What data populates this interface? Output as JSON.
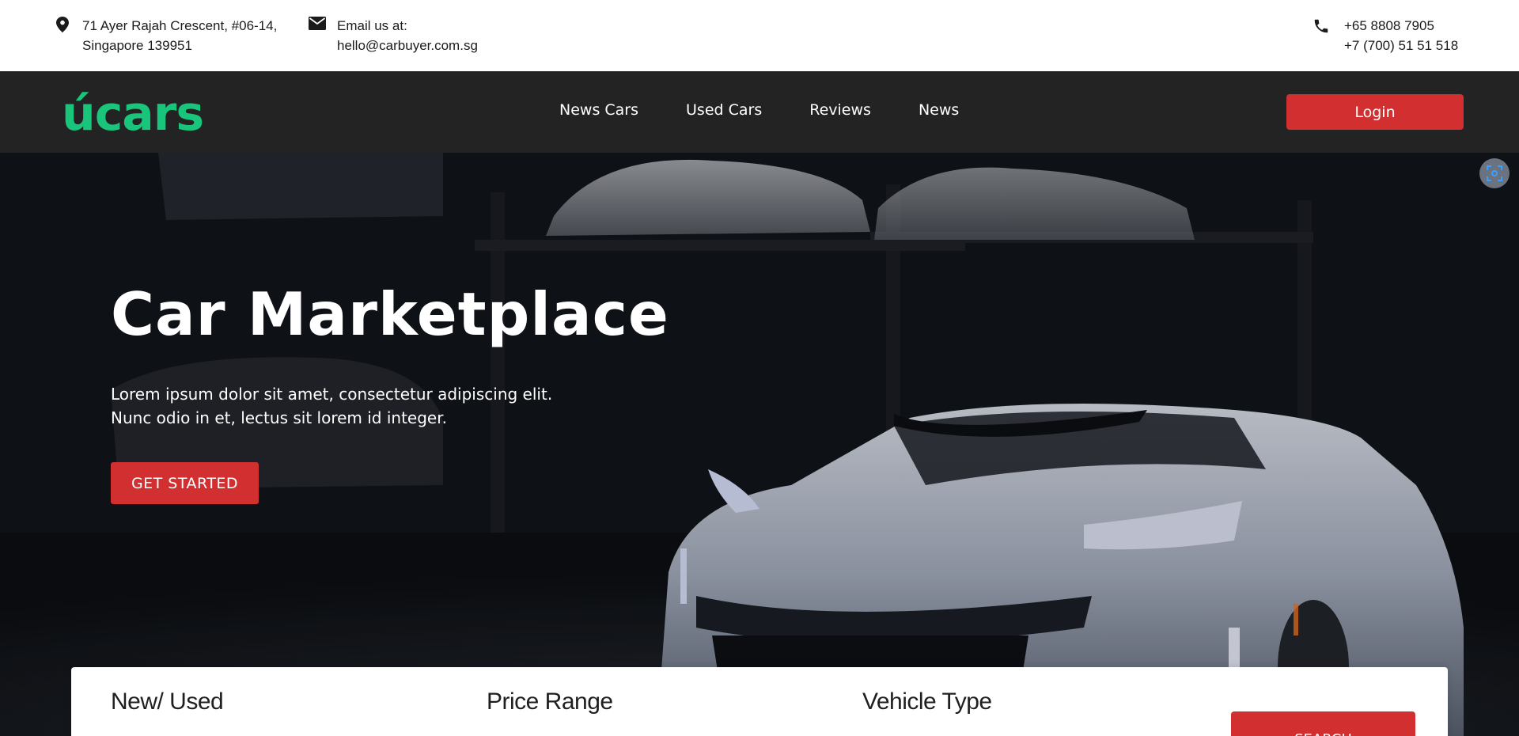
{
  "topbar": {
    "address": {
      "icon": "location-pin-icon",
      "line1": "71 Ayer Rajah Crescent, #06-14,",
      "line2": "Singapore 139951"
    },
    "email": {
      "icon": "envelope-icon",
      "line1": "Email us at:",
      "line2": "hello@carbuyer.com.sg"
    },
    "phone": {
      "icon": "phone-icon",
      "line1": "+65 8808 7905",
      "line2": "+7 (700) 51 51 518"
    }
  },
  "nav": {
    "logo_text": "úcars",
    "logo_color": "#19c57a",
    "links": [
      "News Cars",
      "Used Cars",
      "Reviews",
      "News"
    ],
    "login_label": "Login"
  },
  "hero": {
    "title": "Car Marketplace",
    "subtitle_line1": "Lorem ipsum dolor sit amet, consectetur adipiscing elit.",
    "subtitle_line2": "Nunc odio in et, lectus sit lorem id integer.",
    "cta_label": "GET STARTED",
    "scan_icon": "scan-icon"
  },
  "search_panel": {
    "fields": [
      "New/ Used",
      "Price Range",
      "Vehicle Type"
    ],
    "search_label": "SEARCH"
  },
  "colors": {
    "accent": "#d12f30",
    "nav_bg": "#232323"
  }
}
